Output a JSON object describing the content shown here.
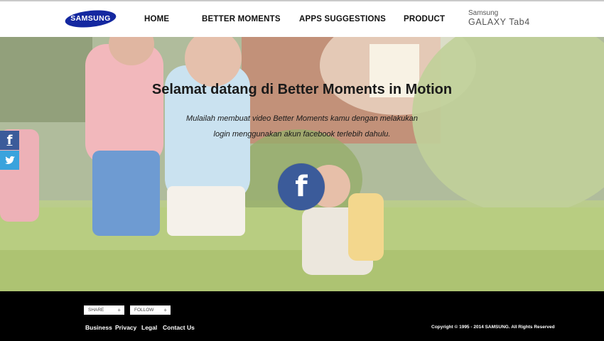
{
  "header": {
    "logo": "SAMSUNG",
    "nav": [
      {
        "label": "HOME"
      },
      {
        "label": "BETTER MOMENTS"
      },
      {
        "label": "APPS SUGGESTIONS"
      },
      {
        "label": "PRODUCT"
      }
    ],
    "product_brand": {
      "line1": "Samsung",
      "line2": "GALAXY Tab4"
    }
  },
  "hero": {
    "title": "Selamat datang di Better Moments in Motion",
    "description": "Mulailah membuat video Better Moments kamu dengan melakukan login menggunakan akun facebook terlebih dahulu.",
    "login_button_icon": "facebook-icon"
  },
  "social_sidebar": [
    {
      "icon": "facebook-icon"
    },
    {
      "icon": "twitter-icon"
    }
  ],
  "footer": {
    "share_label": "SHARE",
    "follow_label": "FOLLOW",
    "links": [
      "Business",
      "Privacy",
      "Legal",
      "Contact Us"
    ],
    "copyright": "Copyright © 1995 - 2014 SAMSUNG. All Rights Reserved"
  },
  "colors": {
    "samsung_blue": "#1428a0",
    "facebook_blue": "#3b5b9a",
    "twitter_blue": "#3aa3dd",
    "footer_bg": "#000000"
  }
}
